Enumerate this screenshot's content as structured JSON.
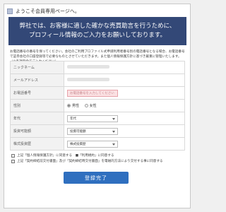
{
  "header": {
    "title": "ようこそ会員専用ページへ。"
  },
  "banner": {
    "line1": "弊社では、お客様に適した確かな売買助言を行うために、",
    "line2": "プロフィール情報のご入力をお願いしております。"
  },
  "description": "お電話番号の番号を保ってください。会社のご利用プロファイル式申請利用者番号別の電話番号となる場合、お電話番号で証券会社の口座登録等で必要なものとさせていただきます。また個人情報保護方針に基づき厳重に管理いたします。（※各項目全てご入力ください）",
  "form": {
    "rows": [
      {
        "label": "ニックネーム",
        "type": "masked"
      },
      {
        "label": "メールアドレス",
        "type": "masked"
      },
      {
        "label": "お電話番号",
        "type": "phone",
        "placeholder": "お電話番号を入力してください"
      },
      {
        "label": "性別",
        "type": "radio",
        "options": [
          "男性",
          "女性"
        ]
      },
      {
        "label": "年代",
        "type": "select",
        "value": "年代"
      },
      {
        "label": "投資可能額",
        "type": "select",
        "value": "投資可能額"
      },
      {
        "label": "株式投資歴",
        "type": "select",
        "value": "株式投資歴"
      }
    ]
  },
  "agreements": [
    "上記「個人情報保護方針」に同意する　■「利用規約」に同意する",
    "上記「契約締結前交付書面」及び「契約締結時交付書面」を電磁的方法により交付する事に同意する"
  ],
  "submit": {
    "label": "登録完了"
  }
}
